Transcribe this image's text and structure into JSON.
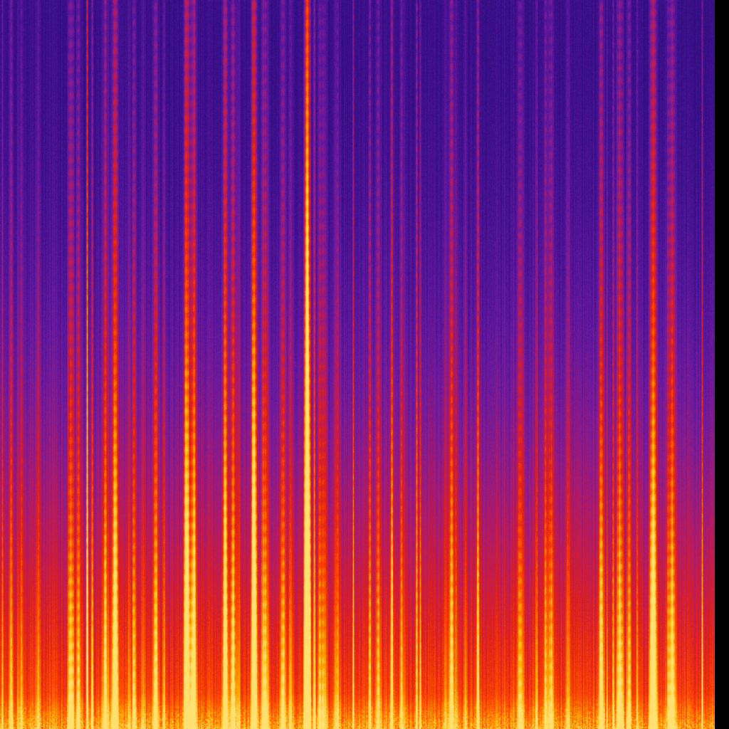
{
  "image": {
    "kind": "spectrogram",
    "colormap": [
      "#1a0b5e",
      "#3b0f8c",
      "#6a1aa0",
      "#b01a6a",
      "#e0201a",
      "#ff4a00",
      "#ffb000",
      "#ffe070"
    ],
    "background_color": "#000000",
    "border_color": "#000000"
  }
}
